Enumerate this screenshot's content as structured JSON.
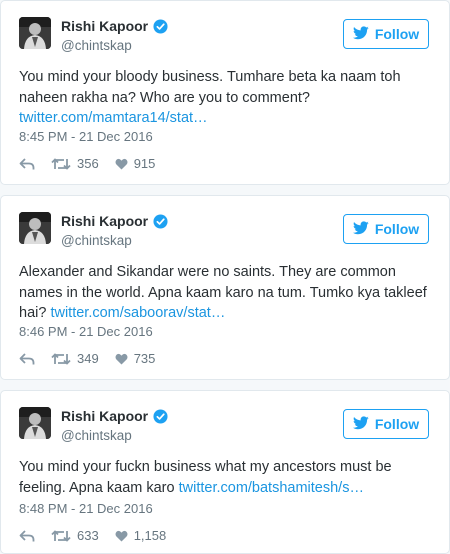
{
  "colors": {
    "accent": "#1da1f2",
    "link": "#1b95e0",
    "muted": "#66757f",
    "text": "#292f33"
  },
  "tweets": [
    {
      "name": "Rishi Kapoor",
      "handle": "@chintskap",
      "follow_label": "Follow",
      "text": "You mind your bloody business. Tumhare beta ka naam toh naheen rakha na? Who are you to comment? ",
      "link": "twitter.com/mamtara14/stat…",
      "time": "8:45 PM - 21 Dec 2016",
      "retweets": "356",
      "likes": "915"
    },
    {
      "name": "Rishi Kapoor",
      "handle": "@chintskap",
      "follow_label": "Follow",
      "text": "Alexander and Sikandar were no saints. They are common names in the world. Apna kaam karo na tum. Tumko kya takleef hai? ",
      "link": "twitter.com/saboorav/stat…",
      "time": "8:46 PM - 21 Dec 2016",
      "retweets": "349",
      "likes": "735"
    },
    {
      "name": "Rishi Kapoor",
      "handle": "@chintskap",
      "follow_label": "Follow",
      "text": "You mind your fuckn business what my ancestors must be feeling. Apna kaam karo ",
      "link": "twitter.com/batshamitesh/s…",
      "time": "8:48 PM - 21 Dec 2016",
      "retweets": "633",
      "likes": "1,158"
    }
  ]
}
